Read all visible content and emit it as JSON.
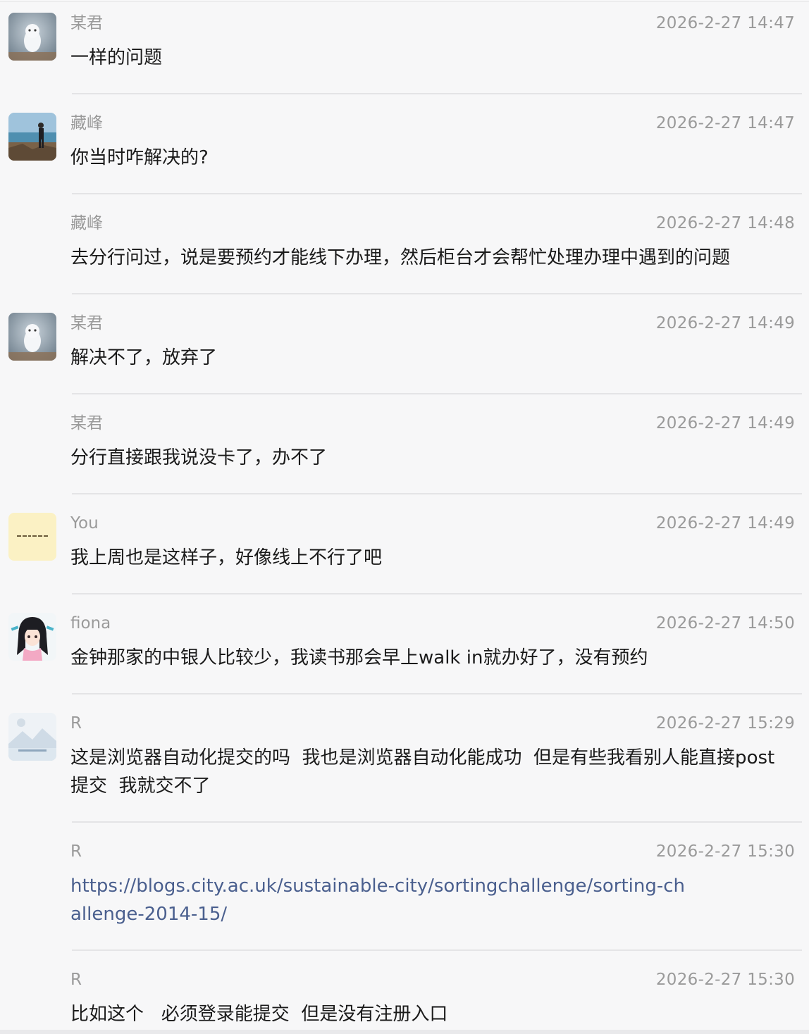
{
  "messages": [
    {
      "sender": "某君",
      "time": "2026-2-27 14:47",
      "text": "一样的问题",
      "avatar_icon": "owl-avatar-icon"
    },
    {
      "sender": "藏峰",
      "time": "2026-2-27 14:47",
      "text": "你当时咋解决的?",
      "avatar_icon": "seaside-photo-avatar-icon"
    },
    {
      "sender": "藏峰",
      "time": "2026-2-27 14:48",
      "text": "去分行问过，说是要预约才能线下办理，然后柜台才会帮忙处理办理中遇到的问题"
    },
    {
      "sender": "某君",
      "time": "2026-2-27 14:49",
      "text": "解决不了，放弃了",
      "avatar_icon": "owl-avatar-icon"
    },
    {
      "sender": "某君",
      "time": "2026-2-27 14:49",
      "text": "分行直接跟我说没卡了，办不了"
    },
    {
      "sender": "You",
      "time": "2026-2-27 14:49",
      "text": "我上周也是这样子，好像线上不行了吧",
      "avatar_icon": "yellow-note-avatar-icon"
    },
    {
      "sender": "fiona",
      "time": "2026-2-27 14:50",
      "text": "金钟那家的中银人比较少，我读书那会早上walk in就办好了，没有预约",
      "avatar_icon": "anime-girl-avatar-icon"
    },
    {
      "sender": "R",
      "time": "2026-2-27 15:29",
      "text": "这是浏览器自动化提交的吗  我也是浏览器自动化能成功  但是有些我看别人能直接post提交  我就交不了",
      "avatar_icon": "landscape-placeholder-avatar-icon"
    },
    {
      "sender": "R",
      "time": "2026-2-27 15:30",
      "text": "https://blogs.city.ac.uk/sustainable-city/sortingchallenge/sorting-challenge-2014-15/",
      "is_link": true
    },
    {
      "sender": "R",
      "time": "2026-2-27 15:30",
      "text": "比如这个   必须登录能提交  但是没有注册入口"
    }
  ],
  "colors": {
    "background": "#f7f7f8",
    "meta_text": "#9a9a9a",
    "body_text": "#1a1a1a",
    "link": "#4a5f8e",
    "divider": "#e4e4e6"
  }
}
